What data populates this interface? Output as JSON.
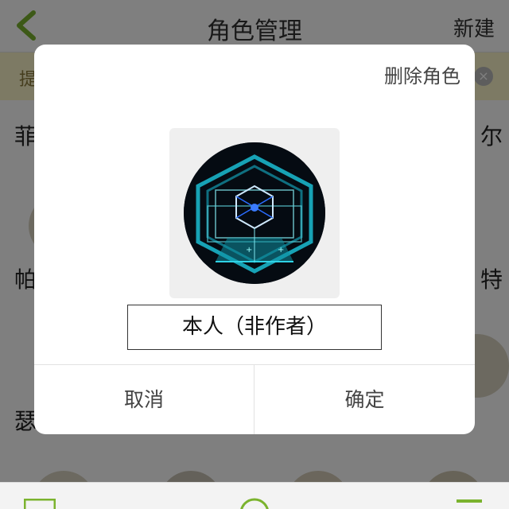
{
  "header": {
    "title": "角色管理",
    "new_label": "新建"
  },
  "tip": {
    "text": "提",
    "close_glyph": "×"
  },
  "background_rows": [
    {
      "left": "菲",
      "right": "尔"
    },
    {
      "left": "帕",
      "right": "特"
    },
    {
      "left": "瑟",
      "right": ""
    }
  ],
  "dialog": {
    "delete_label": "删除角色",
    "name_value": "本人（非作者）",
    "cancel_label": "取消",
    "confirm_label": "确定"
  },
  "colors": {
    "accent_green": "#7bb32e",
    "overlay": "rgba(0,0,0,0.5)"
  },
  "icons": {
    "back": "chevron-left-icon",
    "close": "close-icon",
    "keyboard": "keyboard-icon",
    "add": "add-circle-icon",
    "menu": "menu-icon"
  }
}
